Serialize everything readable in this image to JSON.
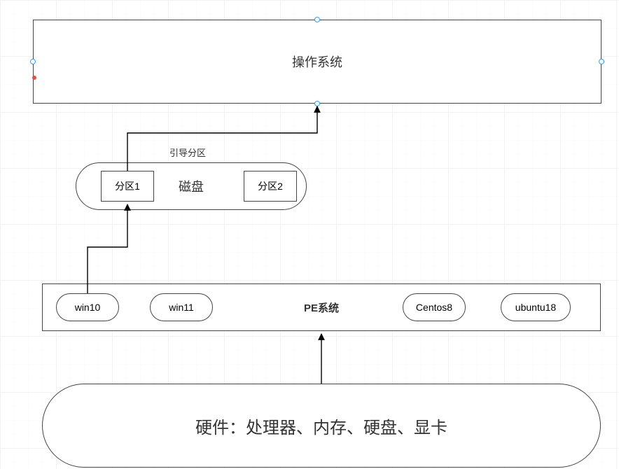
{
  "top_node": {
    "title": "操作系统",
    "selected": true
  },
  "edge_label_boot": "引导分区",
  "disk_node": {
    "title": "磁盘",
    "partitions": [
      "分区1",
      "分区2"
    ]
  },
  "pe_node": {
    "title": "PE系统",
    "items": [
      "win10",
      "win11",
      "Centos8",
      "ubuntu18"
    ]
  },
  "hardware_node": {
    "title": "硬件：处理器、内存、硬盘、显卡"
  },
  "colors": {
    "selection": "#2aa1ff",
    "node_border": "#444444",
    "arrow": "#000000"
  }
}
